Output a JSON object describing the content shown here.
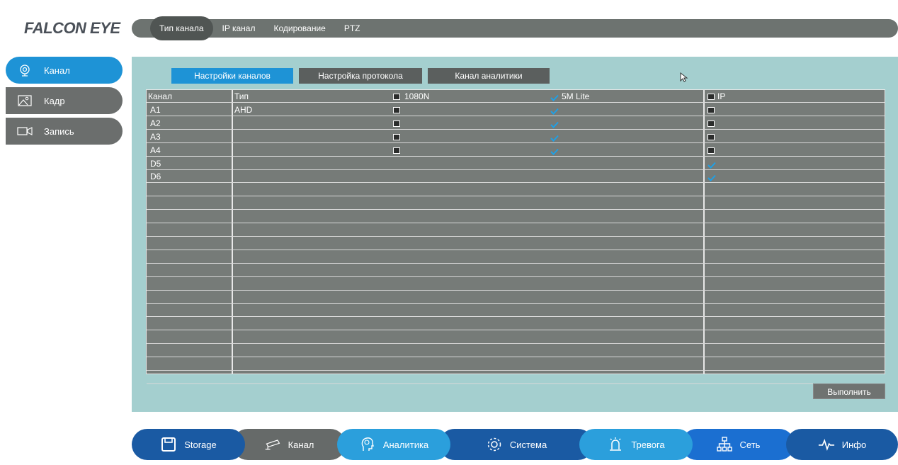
{
  "brand": {
    "logo": "FALCON EYE"
  },
  "top_tabs": [
    {
      "label": "Тип канала",
      "active": true
    },
    {
      "label": "IP канал",
      "active": false
    },
    {
      "label": "Кодирование",
      "active": false
    },
    {
      "label": "PTZ",
      "active": false
    }
  ],
  "sidebar": {
    "items": [
      {
        "label": "Канал",
        "icon": "camera-lens-icon",
        "active": true
      },
      {
        "label": "Кадр",
        "icon": "image-frame-icon",
        "active": false
      },
      {
        "label": "Запись",
        "icon": "video-record-icon",
        "active": false
      }
    ]
  },
  "sub_tabs": [
    {
      "label": "Настройки каналов",
      "active": true
    },
    {
      "label": "Настройка протокола",
      "active": false
    },
    {
      "label": "Канал аналитики",
      "active": false
    }
  ],
  "table": {
    "headers": {
      "channel": "Канал",
      "type": "Тип",
      "col_1080n": "1080N",
      "col_5mlite": "5M Lite",
      "col_ip": "IP"
    },
    "header_checks": {
      "col_1080n": false,
      "col_5mlite": true,
      "col_ip": false
    },
    "rows": [
      {
        "channel": "A1",
        "type": "AHD",
        "c1080n": false,
        "c5mlite": true,
        "ip": false
      },
      {
        "channel": "A2",
        "type": "",
        "c1080n": false,
        "c5mlite": true,
        "ip": false
      },
      {
        "channel": "A3",
        "type": "",
        "c1080n": false,
        "c5mlite": true,
        "ip": false
      },
      {
        "channel": "A4",
        "type": "",
        "c1080n": false,
        "c5mlite": true,
        "ip": false
      },
      {
        "channel": "D5",
        "type": "",
        "c1080n": null,
        "c5mlite": null,
        "ip": true
      },
      {
        "channel": "D6",
        "type": "",
        "c1080n": null,
        "c5mlite": null,
        "ip": true
      }
    ],
    "empty_rows": 15
  },
  "actions": {
    "apply": "Выполнить"
  },
  "bottom_nav": [
    {
      "label": "Storage",
      "icon": "floppy-disk-icon",
      "color": "#1a5aa3"
    },
    {
      "label": "Канал",
      "icon": "cctv-camera-icon",
      "color": "#666a69"
    },
    {
      "label": "Аналитика",
      "icon": "head-brain-icon",
      "color": "#2b9fdc"
    },
    {
      "label": "Система",
      "icon": "gear-icon",
      "color": "#1a5aa3"
    },
    {
      "label": "Тревога",
      "icon": "alarm-beacon-icon",
      "color": "#2b9fdc"
    },
    {
      "label": "Сеть",
      "icon": "network-tree-icon",
      "color": "#1b6fd1"
    },
    {
      "label": "Инфо",
      "icon": "pulse-wave-icon",
      "color": "#1a5aa3"
    }
  ],
  "colors": {
    "accent_blue": "#1e93d6",
    "panel_bg": "#a4cfcf",
    "grid_bg": "#767b78",
    "check_blue": "#1ea0e6"
  }
}
